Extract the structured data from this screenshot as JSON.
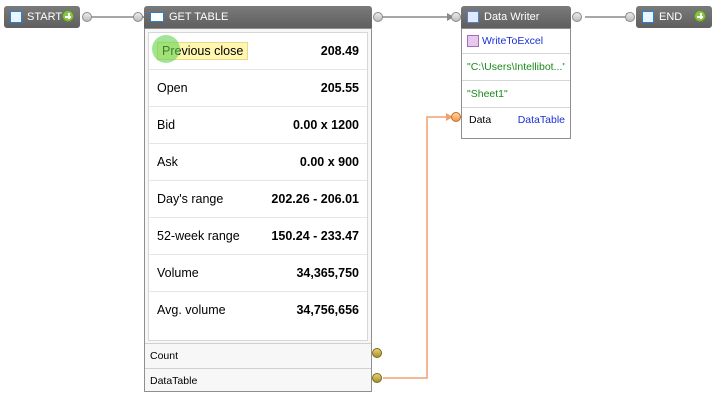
{
  "nodes": {
    "start": {
      "label": "START"
    },
    "get_table": {
      "label": "GET TABLE"
    },
    "data_writer": {
      "label": "Data Writer"
    },
    "end": {
      "label": "END"
    }
  },
  "table": {
    "rows": [
      {
        "label": "Previous close",
        "value": "208.49"
      },
      {
        "label": "Open",
        "value": "205.55"
      },
      {
        "label": "Bid",
        "value": "0.00 x 1200"
      },
      {
        "label": "Ask",
        "value": "0.00 x 900"
      },
      {
        "label": "Day's range",
        "value": "202.26 - 206.01"
      },
      {
        "label": "52-week range",
        "value": "150.24 - 233.47"
      },
      {
        "label": "Volume",
        "value": "34,365,750"
      },
      {
        "label": "Avg. volume",
        "value": "34,756,656"
      }
    ],
    "outputs": {
      "count": "Count",
      "datatable": "DataTable"
    }
  },
  "writer": {
    "method": "WriteToExcel",
    "path": "\"C:\\Users\\Intellibot...\"",
    "sheet": "\"Sheet1\"",
    "data_label": "Data",
    "data_type": "DataTable"
  },
  "colors": {
    "wire": "#8a8a8a",
    "data_wire": "#f0a070",
    "link_blue": "#1a2fd6",
    "string_green": "#1a8a1a",
    "highlight": "#fff7b0"
  }
}
